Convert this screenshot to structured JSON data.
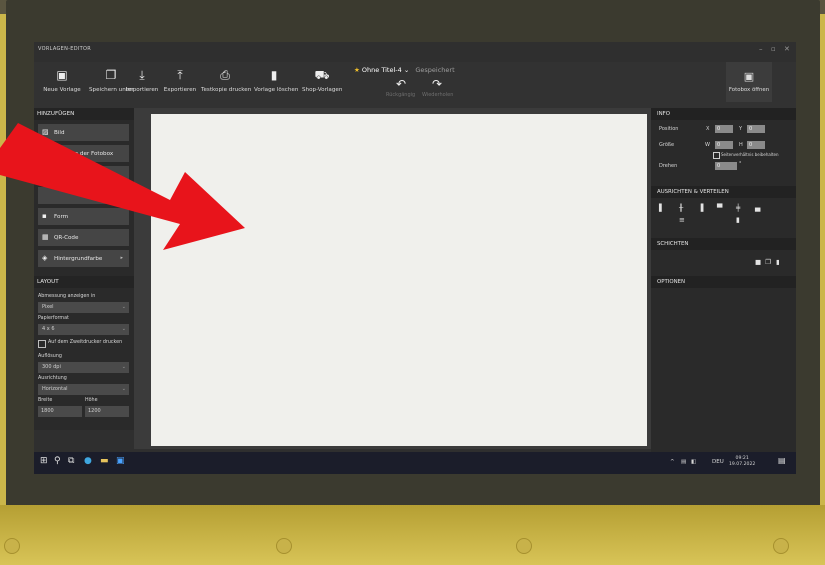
{
  "window": {
    "app_title": "VORLAGEN-EDITOR",
    "controls": [
      "–",
      "▫",
      "✕"
    ]
  },
  "toolbar": {
    "items": [
      {
        "id": "neue-vorlage",
        "icon": "new-template-icon",
        "glyph": "▣",
        "label": "Neue Vorlage"
      },
      {
        "id": "speichern-unter",
        "icon": "save-as-icon",
        "glyph": "❐",
        "label": "Speichern unter"
      },
      {
        "id": "importieren",
        "icon": "import-icon",
        "glyph": "⤓",
        "label": "Importieren"
      },
      {
        "id": "exportieren",
        "icon": "export-icon",
        "glyph": "⤒",
        "label": "Exportieren"
      },
      {
        "id": "testkopie-drucken",
        "icon": "print-icon",
        "glyph": "⎙",
        "label": "Testkopie drucken"
      },
      {
        "id": "vorlage-loeschen",
        "icon": "trash-icon",
        "glyph": "▮",
        "label": "Vorlage löschen"
      },
      {
        "id": "shop-vorlagen",
        "icon": "cart-icon",
        "glyph": "⛟",
        "label": "Shop-Vorlagen"
      }
    ],
    "doc_title": "Ohne Titel-4",
    "doc_title_caret": "⌄",
    "saved_status": "Gespeichert",
    "undo_label": "Rückgängig",
    "redo_label": "Wiederholen",
    "fotobox_label": "Fotobox öffnen"
  },
  "left_panel": {
    "add_heading": "HINZUFÜGEN",
    "add_items": [
      {
        "id": "bild",
        "icon": "image-icon",
        "glyph": "▨",
        "label": "Bild"
      },
      {
        "id": "foto-fotobox",
        "icon": "photobox-icon",
        "glyph": "◫",
        "label": "Foto von der Fotobox"
      },
      {
        "id": "text",
        "icon": "text-icon",
        "glyph": "T",
        "label": "Text"
      },
      {
        "id": "form",
        "icon": "shape-icon",
        "glyph": "▪",
        "label": "Form"
      },
      {
        "id": "qr-code",
        "icon": "qr-icon",
        "glyph": "▦",
        "label": "QR-Code"
      },
      {
        "id": "hintergrundfarbe",
        "icon": "fill-icon",
        "glyph": "◈",
        "label": "Hintergrundfarbe",
        "has_submenu": true,
        "submenu_glyph": "▸"
      }
    ],
    "layout_heading": "LAYOUT",
    "units_label": "Abmessung anzeigen in",
    "units_value": "Pixel",
    "paper_label": "Papierformat",
    "paper_value": "4 x 6",
    "duplex_label": "Auf dem Zweitdrucker drucken",
    "resolution_label": "Auflösung",
    "resolution_value": "300 dpi",
    "orientation_label": "Ausrichtung",
    "orientation_value": "Horizontal",
    "width_label": "Breite",
    "height_label": "Höhe",
    "width_value": "1800",
    "height_value": "1200",
    "select_caret": "⌄"
  },
  "right_panel": {
    "info_heading": "INFO",
    "position_label": "Position",
    "size_label": "Größe",
    "rotate_label": "Drehen",
    "x_label": "X",
    "y_label": "Y",
    "w_label": "W",
    "h_label": "H",
    "x_value": "0",
    "y_value": "0",
    "w_value": "0",
    "h_value": "0",
    "rotate_value": "0",
    "degree": "°",
    "keep_ratio_label": "Seitenverhältnis beibehalten",
    "align_heading": "AUSRICHTEN & VERTEILEN",
    "layers_heading": "SCHICHTEN",
    "options_heading": "OPTIONEN",
    "align_icons": [
      "align-left-icon",
      "align-center-h-icon",
      "align-right-icon",
      "align-top-icon",
      "align-middle-v-icon",
      "align-bottom-icon",
      "distribute-h-icon",
      "distribute-v-icon"
    ],
    "layer_icons": [
      "lock-icon",
      "copy-icon",
      "trash-icon"
    ]
  },
  "taskbar": {
    "icons": [
      "windows-start-icon",
      "search-icon",
      "task-view-icon",
      "edge-icon",
      "file-explorer-icon",
      "app-icon"
    ],
    "tray": "^",
    "language": "DEU",
    "time": "09:21",
    "date": "19.07.2022"
  },
  "colors": {
    "accent_star": "#f3c12a",
    "arrow": "#e8141b",
    "canvas": "#f0f0ec",
    "panel": "#2a2a2a"
  }
}
